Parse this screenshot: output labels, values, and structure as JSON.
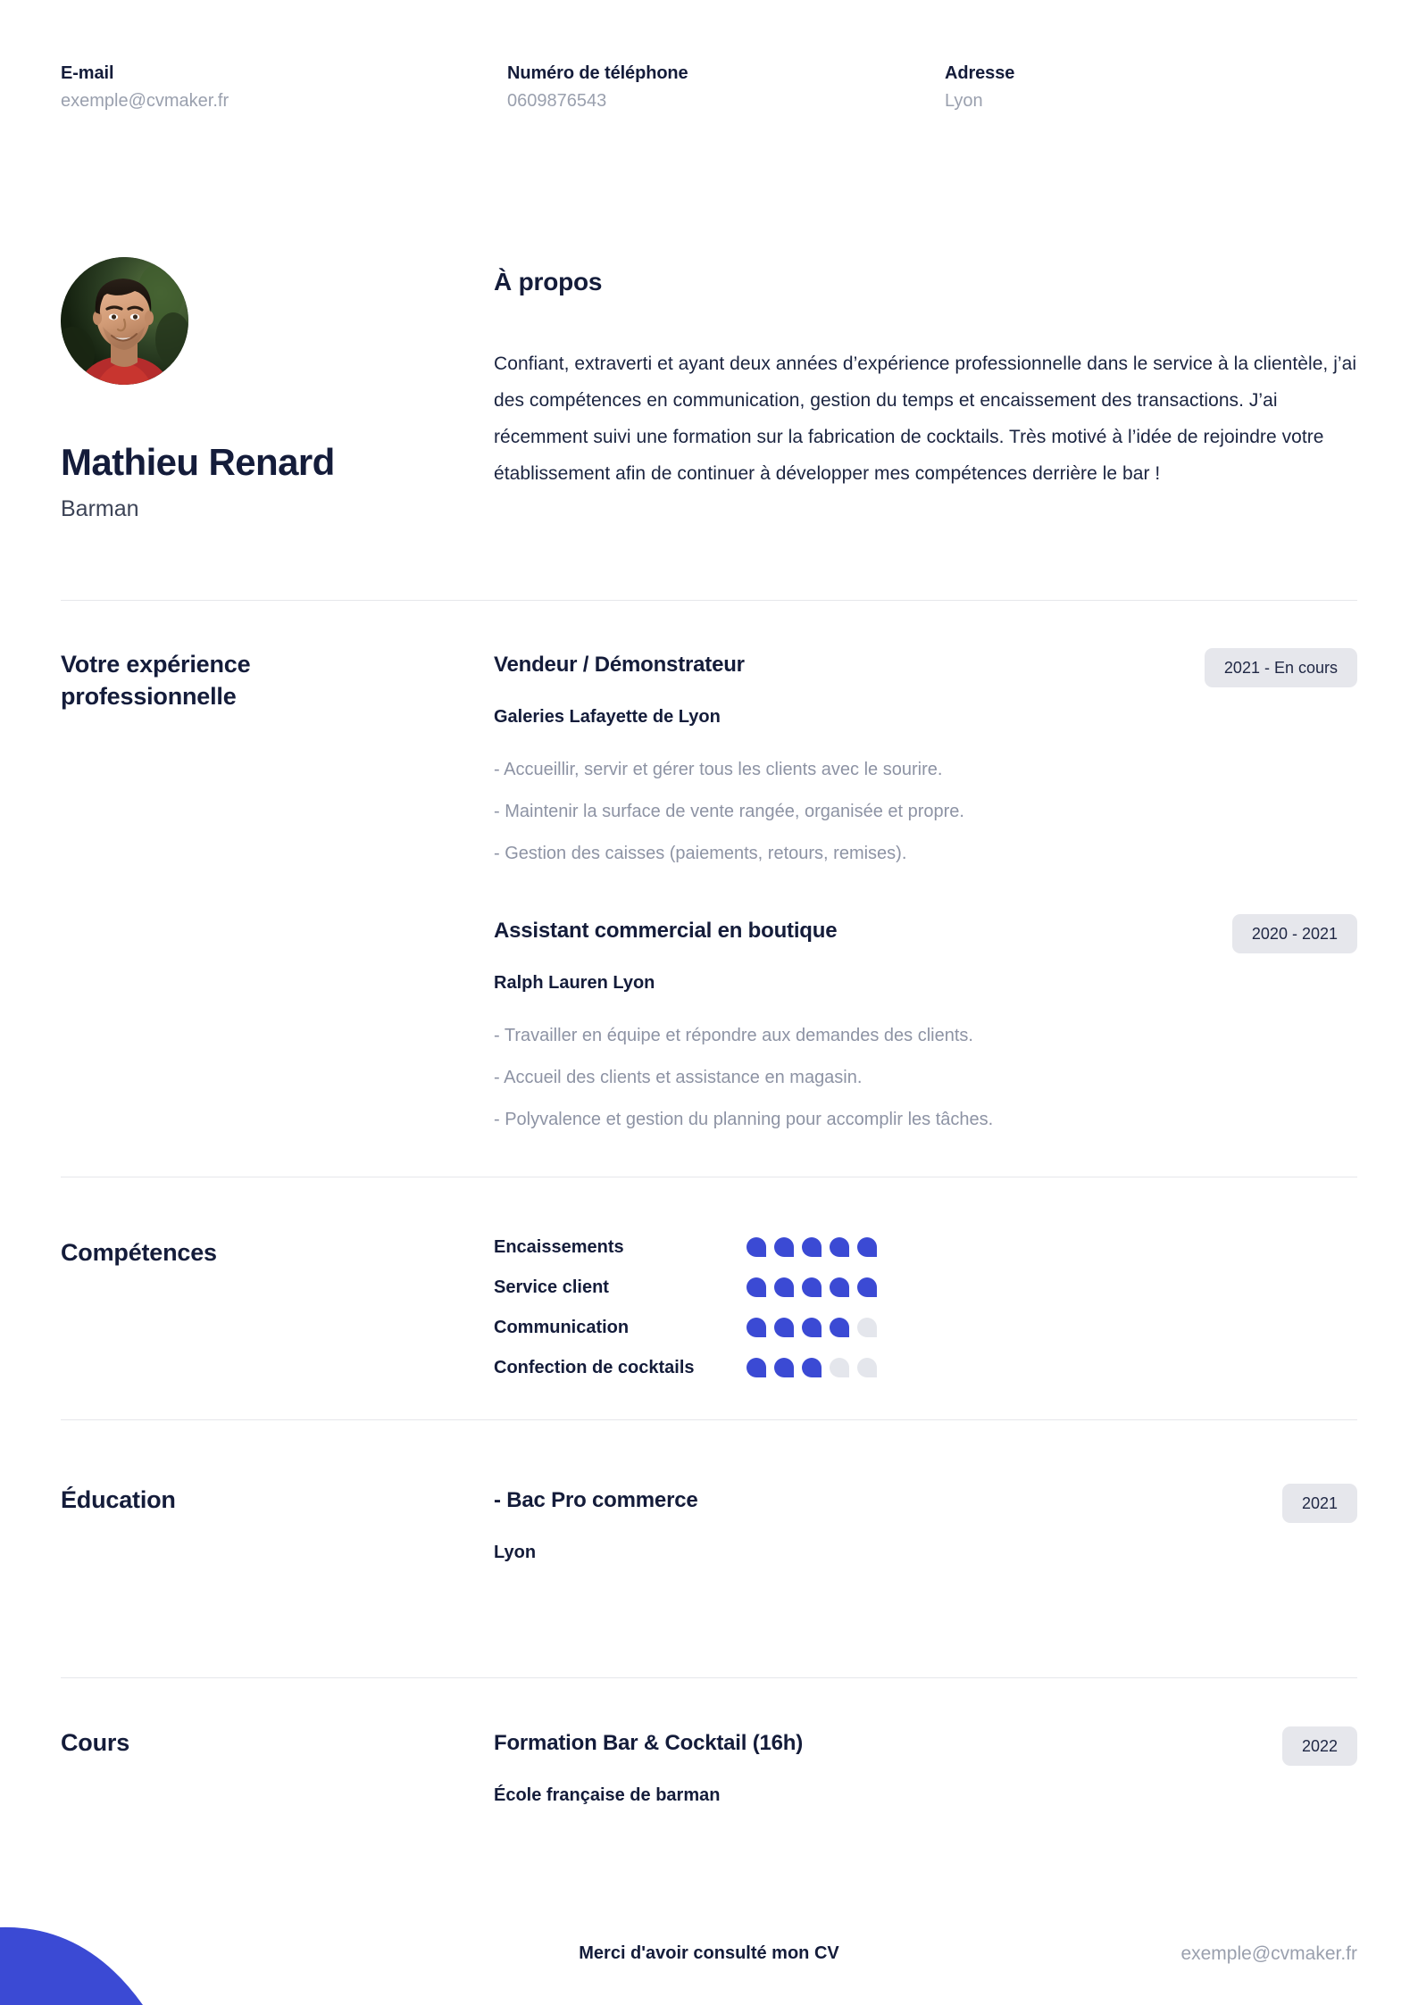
{
  "theme": {
    "accent_blue": "#3b4ad4",
    "navy": "#141c3a",
    "muted_gray": "#8d93a4",
    "badge_bg": "#e6e7ec",
    "empty_dot": "#e4e6ec"
  },
  "contact": {
    "email": {
      "label": "E-mail",
      "value": "exemple@cvmaker.fr"
    },
    "phone": {
      "label": "Numéro de téléphone",
      "value": "0609876543"
    },
    "address": {
      "label": "Adresse",
      "value": "Lyon"
    }
  },
  "identity": {
    "name": "Mathieu Renard",
    "job_title": "Barman"
  },
  "about": {
    "heading": "À propos",
    "text": "Confiant, extraverti et ayant deux années d’expérience professionnelle dans le service à la clientèle, j’ai des compétences en communication, gestion du temps et encaissement des transactions. J’ai récemment suivi une formation sur la fabrication de cocktails. Très motivé à l’idée de rejoindre votre établissement afin de continuer à développer mes compétences derrière le bar !"
  },
  "experience": {
    "title": "Votre expérience professionnelle",
    "entries": [
      {
        "role": "Vendeur / Démonstrateur",
        "organisation": "Galeries Lafayette de Lyon",
        "period": "2021 - En cours",
        "bullets": [
          "- Accueillir, servir et gérer tous les clients avec le sourire.",
          "- Maintenir la surface de vente rangée, organisée et propre.",
          "- Gestion des caisses (paiements, retours, remises)."
        ]
      },
      {
        "role": "Assistant commercial en boutique",
        "organisation": "Ralph Lauren Lyon",
        "period": "2020 - 2021",
        "bullets": [
          "- Travailler en équipe et répondre aux demandes des clients.",
          "- Accueil des clients et assistance en magasin.",
          "- Polyvalence et gestion du planning pour accomplir les tâches."
        ]
      }
    ]
  },
  "skills": {
    "title": "Compétences",
    "max_level": 5,
    "items": [
      {
        "name": "Encaissements",
        "level": 5
      },
      {
        "name": "Service client",
        "level": 5
      },
      {
        "name": "Communication",
        "level": 4
      },
      {
        "name": "Confection de cocktails",
        "level": 3
      }
    ]
  },
  "education": {
    "title": "Éducation",
    "entries": [
      {
        "degree": "- Bac Pro commerce",
        "location": "Lyon",
        "period": "2021"
      }
    ]
  },
  "courses": {
    "title": "Cours",
    "entries": [
      {
        "course": "Formation Bar & Cocktail (16h)",
        "institution": "École française de barman",
        "period": "2022"
      }
    ]
  },
  "footer": {
    "note": "Merci d'avoir consulté mon CV",
    "email": "exemple@cvmaker.fr"
  }
}
